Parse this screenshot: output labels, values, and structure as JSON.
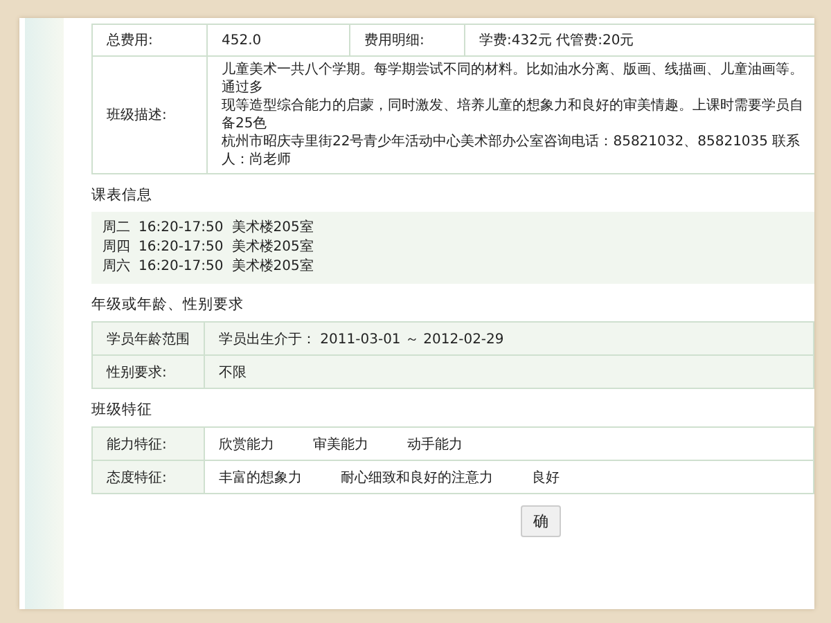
{
  "fee_table": {
    "rows": [
      {
        "cells": [
          {
            "kind": "label",
            "text": "总费用:"
          },
          {
            "kind": "value",
            "text": "452.0"
          },
          {
            "kind": "label",
            "text": "费用明细:"
          },
          {
            "kind": "value",
            "text": "学费:432元 代管费:20元"
          }
        ]
      },
      {
        "cells": [
          {
            "kind": "label",
            "text": "班级描述:"
          },
          {
            "kind": "lines",
            "colspan": 3,
            "lines": [
              "儿童美术一共八个学期。每学期尝试不同的材料。比如油水分离、版画、线描画、儿童油画等。通过多",
              "现等造型综合能力的启蒙，同时激发、培养儿童的想象力和良好的审美情趣。上课时需要学员自备25色",
              "杭州市昭庆寺里街22号青少年活动中心美术部办公室咨询电话：85821032、85821035 联系人：尚老师"
            ]
          }
        ]
      }
    ]
  },
  "schedule": {
    "title": "课表信息",
    "entries": [
      {
        "day": "周二",
        "time": "16:20-17:50",
        "room": "美术楼205室"
      },
      {
        "day": "周四",
        "time": "16:20-17:50",
        "room": "美术楼205室"
      },
      {
        "day": "周六",
        "time": "16:20-17:50",
        "room": "美术楼205室"
      }
    ]
  },
  "requirements": {
    "title": "年级或年龄、性别要求",
    "rows": [
      {
        "label": "学员年龄范围",
        "value": "学员出生介于： 2011-03-01 ～ 2012-02-29"
      },
      {
        "label": "性别要求:",
        "value": "不限"
      }
    ]
  },
  "features": {
    "title": "班级特征",
    "rows": [
      {
        "label": "能力特征:",
        "items": [
          "欣赏能力",
          "审美能力",
          "动手能力"
        ]
      },
      {
        "label": "态度特征:",
        "items": [
          "丰富的想象力",
          "耐心细致和良好的注意力",
          "良好"
        ]
      }
    ]
  },
  "buttons": [
    "确"
  ]
}
